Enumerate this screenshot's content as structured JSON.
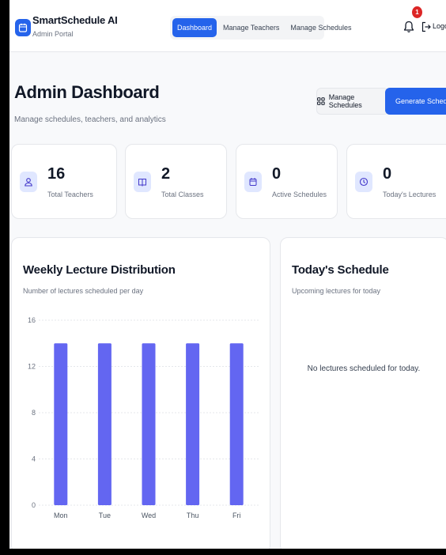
{
  "header": {
    "brand_title": "SmartSchedule AI",
    "brand_subtitle": "Admin Portal",
    "nav": [
      "Dashboard",
      "Manage Teachers",
      "Manage Schedules"
    ],
    "active_nav": "Dashboard",
    "notification_count": "1",
    "logout_label": "Logou"
  },
  "page": {
    "title": "Admin Dashboard",
    "subtitle": "Manage schedules, teachers, and analytics",
    "manage_button": "Manage Schedules",
    "generate_button": "Generate Schedule"
  },
  "stats": [
    {
      "value": "16",
      "label": "Total Teachers",
      "icon": "users-icon"
    },
    {
      "value": "2",
      "label": "Total Classes",
      "icon": "book-icon"
    },
    {
      "value": "0",
      "label": "Active Schedules",
      "icon": "calendar-icon"
    },
    {
      "value": "0",
      "label": "Today's Lectures",
      "icon": "clock-icon"
    }
  ],
  "chart_panel": {
    "title": "Weekly Lecture Distribution",
    "subtitle": "Number of lectures scheduled per day"
  },
  "schedule_panel": {
    "title": "Today's Schedule",
    "subtitle": "Upcoming lectures for today",
    "empty_message": "No lectures scheduled for today."
  },
  "colors": {
    "primary": "#2563eb",
    "bar": "#6366f1",
    "badge": "#dc2626"
  },
  "chart_data": {
    "type": "bar",
    "categories": [
      "Mon",
      "Tue",
      "Wed",
      "Thu",
      "Fri"
    ],
    "values": [
      14,
      14,
      14,
      14,
      14
    ],
    "yticks": [
      0,
      4,
      8,
      12,
      16
    ],
    "ylim": [
      0,
      16
    ],
    "grid": true
  }
}
